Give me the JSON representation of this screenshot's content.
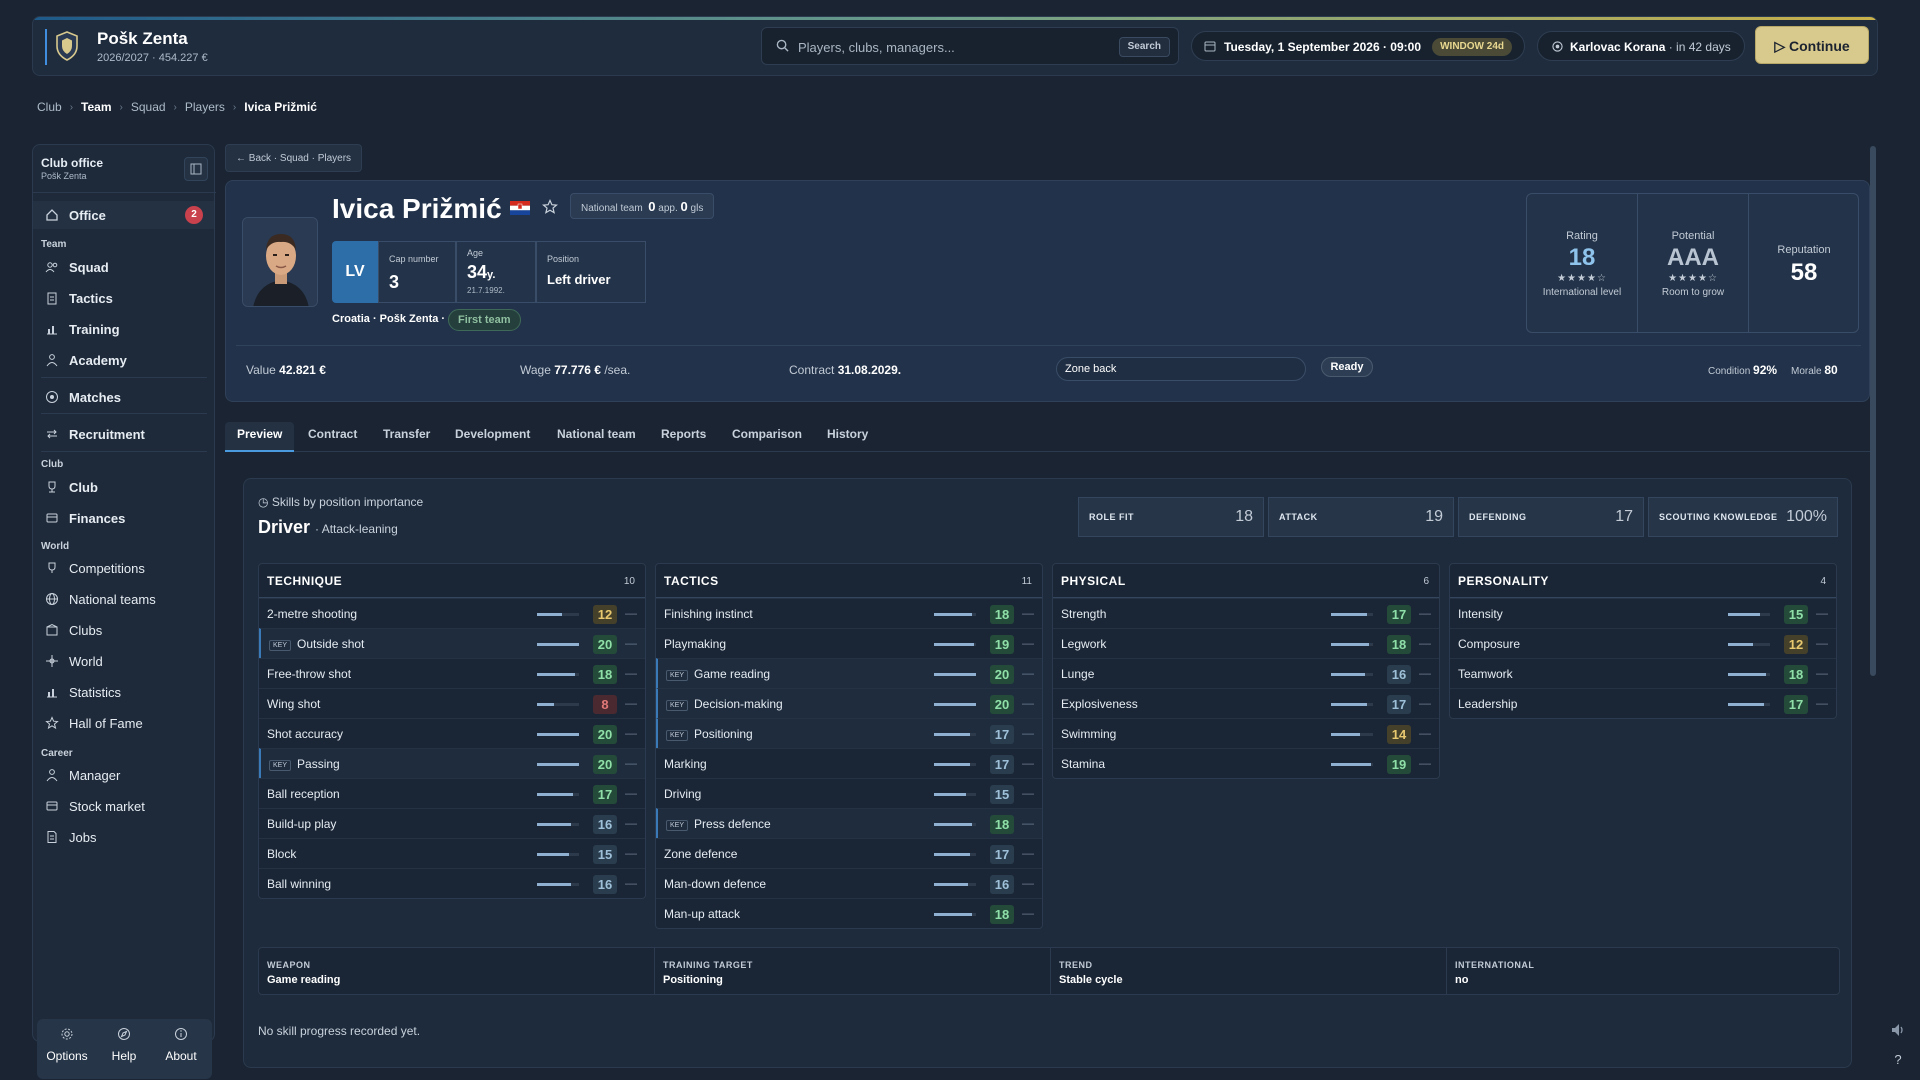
{
  "topbar": {
    "club_name": "Pošk Zenta",
    "season_balance": "2026/2027 · 454.227 €",
    "search_placeholder": "Players, clubs, managers...",
    "search_button": "Search",
    "date": "Tuesday, 1 September 2026 · 09:00",
    "window_badge": "WINDOW 24d",
    "next_opponent": "Karlovac Korana",
    "next_in": "· in 42 days",
    "continue_label": "Continue"
  },
  "breadcrumb": [
    "Club",
    "Team",
    "Squad",
    "Players",
    "Ivica Prižmić"
  ],
  "sidebar": {
    "title": "Club office",
    "subtitle": "Pošk Zenta",
    "office_label": "Office",
    "office_badge": "2",
    "sections": {
      "team": "Team",
      "club": "Club",
      "world": "World",
      "career": "Career"
    },
    "team_items": [
      "Squad",
      "Tactics",
      "Training",
      "Academy"
    ],
    "matches_label": "Matches",
    "recruitment_label": "Recruitment",
    "club_items": [
      "Club",
      "Finances"
    ],
    "world_items": [
      "Competitions",
      "National teams",
      "Clubs",
      "World",
      "Statistics",
      "Hall of Fame"
    ],
    "career_items": [
      "Manager",
      "Stock market",
      "Jobs"
    ],
    "footer": [
      "Options",
      "Help",
      "About"
    ]
  },
  "back_label": "← Back · Squad · Players",
  "player": {
    "name": "Ivica Prižmić",
    "national_team_label": "National team",
    "apps": "0",
    "apps_unit": "app.",
    "goals": "0",
    "goals_unit": "gls",
    "position_code": "LV",
    "cap_label": "Cap number",
    "cap": "3",
    "age_label": "Age",
    "age": "34",
    "age_unit": "y.",
    "dob": "21.7.1992.",
    "position_label": "Position",
    "position": "Left driver",
    "club_line": "Croatia · Pošk Zenta ·",
    "squad_status": "First team"
  },
  "ratings": {
    "rating_label": "Rating",
    "rating": "18",
    "rating_stars": "★★★★☆",
    "rating_sub": "International level",
    "potential_label": "Potential",
    "potential": "AAA",
    "potential_stars": "★★★★☆",
    "potential_sub": "Room to grow",
    "reputation_label": "Reputation",
    "reputation": "58"
  },
  "contract_strip": {
    "value_label": "Value",
    "value": "42.821 €",
    "wage_label": "Wage",
    "wage": "77.776 €",
    "wage_unit": "/sea.",
    "contract_label": "Contract",
    "contract": "31.08.2029.",
    "role_select": "Zone back",
    "ready": "Ready",
    "condition_label": "Condition",
    "condition": "92%",
    "morale_label": "Morale",
    "morale": "80"
  },
  "tabs": [
    "Preview",
    "Contract",
    "Transfer",
    "Development",
    "National team",
    "Reports",
    "Comparison",
    "History"
  ],
  "skills": {
    "heading": "Skills by position importance",
    "role": "Driver",
    "role_sub": "· Attack-leaning",
    "summary": [
      {
        "label": "ROLE FIT",
        "value": "18"
      },
      {
        "label": "ATTACK",
        "value": "19"
      },
      {
        "label": "DEFENDING",
        "value": "17"
      },
      {
        "label": "SCOUTING KNOWLEDGE",
        "value": "100%"
      }
    ],
    "key_tag": "KEY",
    "dash": "—",
    "columns": [
      {
        "title": "TECHNIQUE",
        "count": "10",
        "rows": [
          {
            "name": "2-metre shooting",
            "value": 12,
            "key": false,
            "tone": "y"
          },
          {
            "name": "Outside shot",
            "value": 20,
            "key": true,
            "tone": "g"
          },
          {
            "name": "Free-throw shot",
            "value": 18,
            "key": false,
            "tone": "g"
          },
          {
            "name": "Wing shot",
            "value": 8,
            "key": false,
            "tone": "r"
          },
          {
            "name": "Shot accuracy",
            "value": 20,
            "key": false,
            "tone": "g"
          },
          {
            "name": "Passing",
            "value": 20,
            "key": true,
            "tone": "g"
          },
          {
            "name": "Ball reception",
            "value": 17,
            "key": false,
            "tone": "g"
          },
          {
            "name": "Build-up play",
            "value": 16,
            "key": false,
            "tone": "n"
          },
          {
            "name": "Block",
            "value": 15,
            "key": false,
            "tone": "n"
          },
          {
            "name": "Ball winning",
            "value": 16,
            "key": false,
            "tone": "n"
          }
        ]
      },
      {
        "title": "TACTICS",
        "count": "11",
        "rows": [
          {
            "name": "Finishing instinct",
            "value": 18,
            "key": false,
            "tone": "g"
          },
          {
            "name": "Playmaking",
            "value": 19,
            "key": false,
            "tone": "g"
          },
          {
            "name": "Game reading",
            "value": 20,
            "key": true,
            "tone": "g"
          },
          {
            "name": "Decision-making",
            "value": 20,
            "key": true,
            "tone": "g"
          },
          {
            "name": "Positioning",
            "value": 17,
            "key": true,
            "tone": "n"
          },
          {
            "name": "Marking",
            "value": 17,
            "key": false,
            "tone": "n"
          },
          {
            "name": "Driving",
            "value": 15,
            "key": false,
            "tone": "n"
          },
          {
            "name": "Press defence",
            "value": 18,
            "key": true,
            "tone": "g"
          },
          {
            "name": "Zone defence",
            "value": 17,
            "key": false,
            "tone": "n"
          },
          {
            "name": "Man-down defence",
            "value": 16,
            "key": false,
            "tone": "n"
          },
          {
            "name": "Man-up attack",
            "value": 18,
            "key": false,
            "tone": "g"
          }
        ]
      },
      {
        "title": "PHYSICAL",
        "count": "6",
        "rows": [
          {
            "name": "Strength",
            "value": 17,
            "key": false,
            "tone": "g"
          },
          {
            "name": "Legwork",
            "value": 18,
            "key": false,
            "tone": "g"
          },
          {
            "name": "Lunge",
            "value": 16,
            "key": false,
            "tone": "n"
          },
          {
            "name": "Explosiveness",
            "value": 17,
            "key": false,
            "tone": "n"
          },
          {
            "name": "Swimming",
            "value": 14,
            "key": false,
            "tone": "y"
          },
          {
            "name": "Stamina",
            "value": 19,
            "key": false,
            "tone": "g"
          }
        ]
      },
      {
        "title": "PERSONALITY",
        "count": "4",
        "rows": [
          {
            "name": "Intensity",
            "value": 15,
            "key": false,
            "tone": "g"
          },
          {
            "name": "Composure",
            "value": 12,
            "key": false,
            "tone": "y"
          },
          {
            "name": "Teamwork",
            "value": 18,
            "key": false,
            "tone": "g"
          },
          {
            "name": "Leadership",
            "value": 17,
            "key": false,
            "tone": "g"
          }
        ]
      }
    ],
    "footer": [
      {
        "label": "WEAPON",
        "value": "Game reading"
      },
      {
        "label": "TRAINING TARGET",
        "value": "Positioning"
      },
      {
        "label": "TREND",
        "value": "Stable cycle"
      },
      {
        "label": "INTERNATIONAL",
        "value": "no"
      }
    ],
    "no_progress": "No skill progress recorded yet."
  }
}
